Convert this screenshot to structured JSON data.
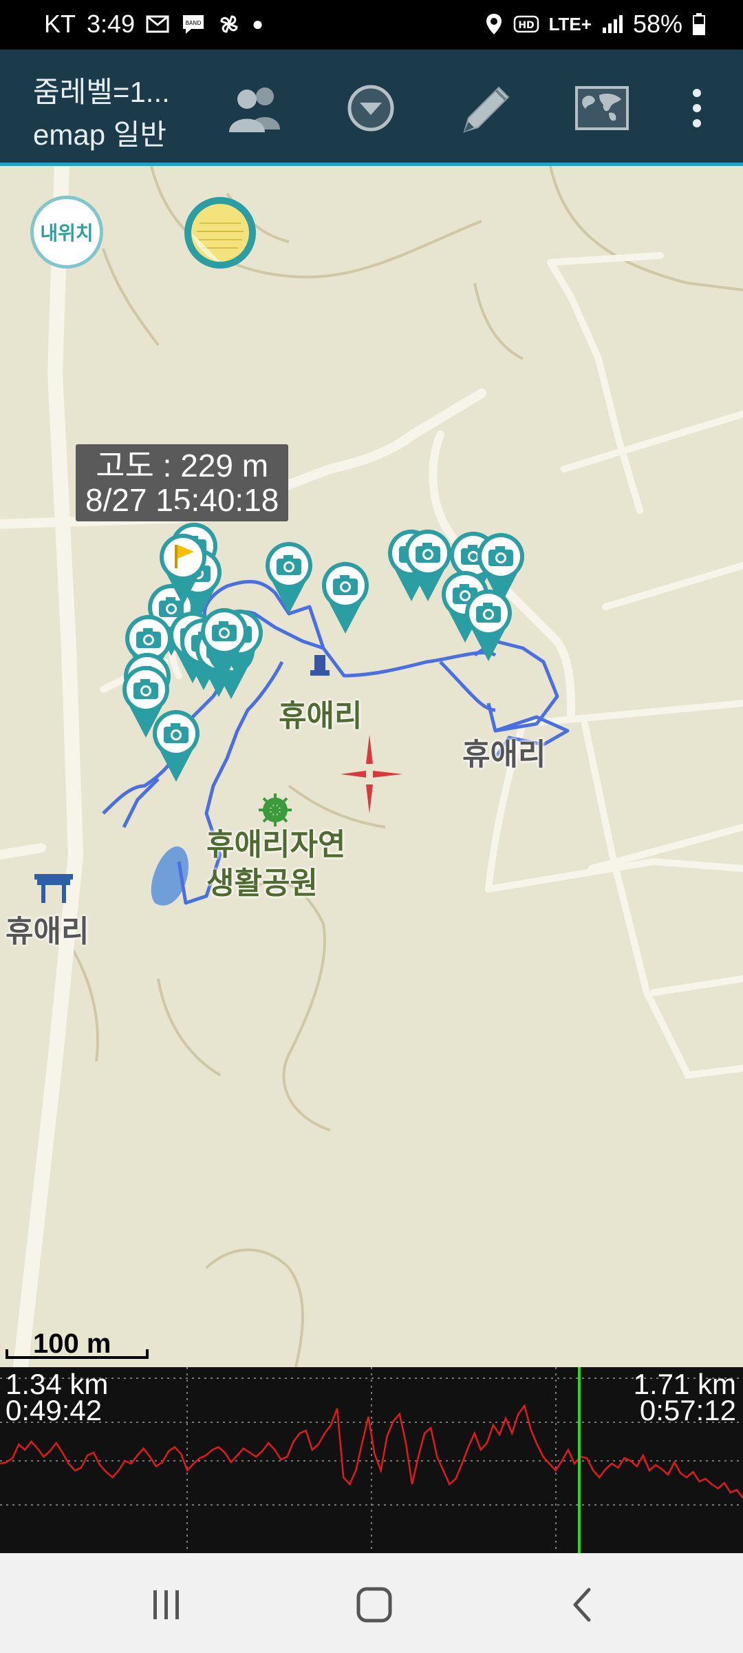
{
  "status_bar": {
    "carrier": "KT",
    "time": "3:49",
    "battery": "58%",
    "network": "LTE+",
    "icons_left": [
      "mail-icon",
      "band-icon",
      "pinwheel-icon",
      "dot-icon"
    ],
    "icons_right": [
      "location-icon",
      "hd-icon",
      "lte-icon",
      "signal-icon",
      "battery-icon"
    ]
  },
  "app_bar": {
    "title_line1": "줌레벨=1...",
    "title_line2": "emap 일반",
    "actions": [
      "people-icon",
      "dropdown-icon",
      "pencil-icon",
      "world-map-icon",
      "more-vert-icon"
    ]
  },
  "map": {
    "my_location_label": "내위치",
    "tooltip": {
      "altitude": "고도 : 229 m",
      "datetime": "8/27 15:40:18"
    },
    "place_labels": [
      "휴애리",
      "휴애리자연\n생활공원",
      "휴애리",
      "휴애리"
    ],
    "scale_label": "100 m",
    "accent_color": "#2b9ea4",
    "track_color": "#4a6fe0"
  },
  "graph": {
    "left_distance": "1.34 km",
    "left_time": "0:49:42",
    "right_distance": "1.71 km",
    "right_time": "0:57:12",
    "line_color": "#e01b1b",
    "cursor_color": "#22dd22"
  },
  "nav_bar": {
    "buttons": [
      "recent-apps-icon",
      "home-icon",
      "back-icon"
    ]
  }
}
